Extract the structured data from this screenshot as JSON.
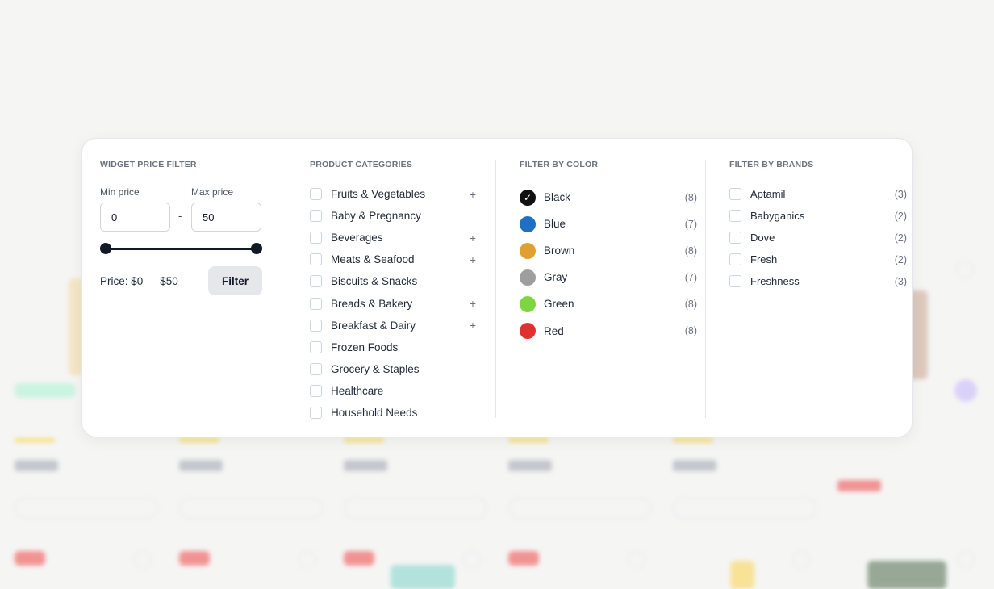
{
  "price_filter": {
    "title": "WIDGET PRICE FILTER",
    "min_label": "Min price",
    "max_label": "Max price",
    "min_value": "0",
    "max_value": "50",
    "separator": "-",
    "range_text": "Price: $0 — $50",
    "slider_min_fraction": 0,
    "slider_max_fraction": 1,
    "filter_button": "Filter"
  },
  "categories": {
    "title": "PRODUCT CATEGORIES",
    "items": [
      {
        "label": "Fruits & Vegetables",
        "expandable": true
      },
      {
        "label": "Baby & Pregnancy",
        "expandable": false
      },
      {
        "label": "Beverages",
        "expandable": true
      },
      {
        "label": "Meats & Seafood",
        "expandable": true
      },
      {
        "label": "Biscuits & Snacks",
        "expandable": false
      },
      {
        "label": "Breads & Bakery",
        "expandable": true
      },
      {
        "label": "Breakfast & Dairy",
        "expandable": true
      },
      {
        "label": "Frozen Foods",
        "expandable": false
      },
      {
        "label": "Grocery & Staples",
        "expandable": false
      },
      {
        "label": "Healthcare",
        "expandable": false
      },
      {
        "label": "Household Needs",
        "expandable": false
      }
    ],
    "expand_symbol": "+"
  },
  "colors": {
    "title": "FILTER BY COLOR",
    "items": [
      {
        "label": "Black",
        "count": "(8)",
        "hex": "#111111",
        "selected": true
      },
      {
        "label": "Blue",
        "count": "(7)",
        "hex": "#1f6fc5",
        "selected": false
      },
      {
        "label": "Brown",
        "count": "(8)",
        "hex": "#e0a02f",
        "selected": false
      },
      {
        "label": "Gray",
        "count": "(7)",
        "hex": "#9e9e9e",
        "selected": false
      },
      {
        "label": "Green",
        "count": "(8)",
        "hex": "#7dd63f",
        "selected": false
      },
      {
        "label": "Red",
        "count": "(8)",
        "hex": "#e03131",
        "selected": false
      }
    ]
  },
  "brands": {
    "title": "FILTER BY BRANDS",
    "items": [
      {
        "label": "Aptamil",
        "count": "(3)"
      },
      {
        "label": "Babyganics",
        "count": "(2)"
      },
      {
        "label": "Dove",
        "count": "(2)"
      },
      {
        "label": "Fresh",
        "count": "(2)"
      },
      {
        "label": "Freshness",
        "count": "(3)"
      }
    ]
  }
}
